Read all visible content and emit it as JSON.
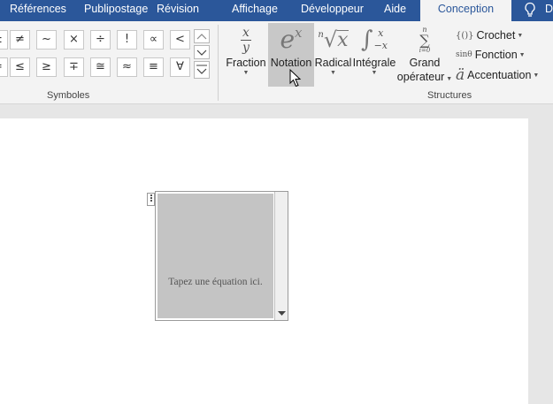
{
  "tabs": [
    {
      "label": "Références"
    },
    {
      "label": "Publipostage"
    },
    {
      "label": "Révision"
    },
    {
      "label": "Affichage"
    },
    {
      "label": "Développeur"
    },
    {
      "label": "Aide"
    },
    {
      "label": "Conception"
    }
  ],
  "tab_partial": "D",
  "symbols": {
    "row1": [
      "±",
      "≠",
      "~",
      "×",
      "÷",
      "!",
      "∝",
      "<"
    ],
    "row2": [
      "=",
      "≤",
      "≥",
      "∓",
      "≅",
      "≈",
      "≡",
      "∀"
    ],
    "group_label": "Symboles"
  },
  "structures": {
    "group_label": "Structures",
    "fraction": {
      "label": "Fraction",
      "num": "x",
      "den": "y"
    },
    "notation": {
      "label": "Notation",
      "base": "e",
      "exp": "x"
    },
    "radical": {
      "label": "Radical",
      "index": "n",
      "radicand": "x"
    },
    "integrale": {
      "label": "Intégrale",
      "upper": "x",
      "lower": "−x"
    },
    "grand_operateur": {
      "label_line1": "Grand",
      "label_line2": "opérateur",
      "sym": "∑",
      "upper": "n",
      "lower": "i=0"
    },
    "crochet": {
      "label": "Crochet",
      "icon": "{()}"
    },
    "fonction": {
      "label": "Fonction",
      "icon": "sinθ"
    },
    "accentuation": {
      "label": "Accentuation",
      "icon": "ä"
    }
  },
  "equation": {
    "placeholder": "Tapez une équation ici."
  },
  "colors": {
    "tab_bar": "#2b579a",
    "ribbon": "#f3f3f3",
    "hover": "#c8c8c8",
    "equation_fill": "#c4c4c4"
  }
}
